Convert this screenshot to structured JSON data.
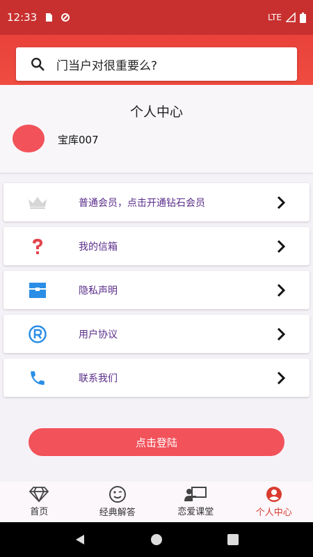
{
  "status_bar": {
    "time": "12:33",
    "network": "LTE"
  },
  "search": {
    "placeholder": "门当户对很重要么?"
  },
  "profile": {
    "title": "个人中心",
    "username": "宝库007"
  },
  "menu": [
    {
      "label": "普通会员，点击开通钻石会员",
      "icon": "crown-icon"
    },
    {
      "label": "我的信箱",
      "icon": "question-icon"
    },
    {
      "label": "隐私声明",
      "icon": "box-icon"
    },
    {
      "label": "用户协议",
      "icon": "registered-icon"
    },
    {
      "label": "联系我们",
      "icon": "phone-icon"
    }
  ],
  "login_button": "点击登陆",
  "bottom_nav": [
    {
      "label": "首页",
      "icon": "diamond-icon",
      "active": false
    },
    {
      "label": "经典解答",
      "icon": "smile-icon",
      "active": false
    },
    {
      "label": "恋爱课堂",
      "icon": "classroom-icon",
      "active": false
    },
    {
      "label": "个人中心",
      "icon": "account-icon",
      "active": true
    }
  ],
  "colors": {
    "status_bar": "#c8302f",
    "accent": "#f2525a",
    "active_tab": "#d93a2f",
    "menu_text": "#5a2d8a"
  }
}
